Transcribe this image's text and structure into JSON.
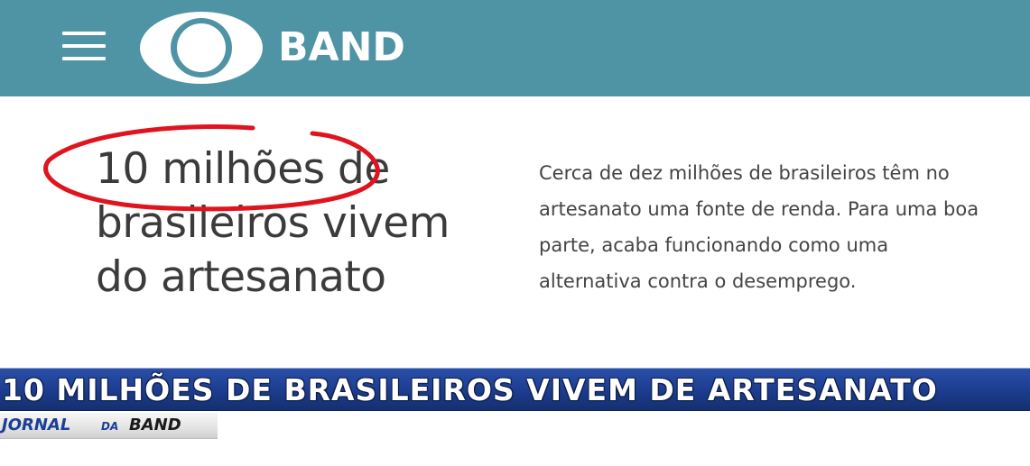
{
  "header": {
    "brand_name": "BAND",
    "menu_icon": "hamburger-menu-icon",
    "logo_icon": "band-eye-logo-icon",
    "background_color": "#4f94a4"
  },
  "article": {
    "headline": "10 milhões de brasileiros vivem do artesanato",
    "summary": "Cerca de dez milhões de brasileiros têm no artesanato uma fonte de renda. Para uma boa parte, acaba funcionando como uma alternativa contra o desemprego.",
    "highlight_color": "#e0141e"
  },
  "broadcast": {
    "chyron": "10 MILHÕES DE BRASILEIROS VIVEM DE ARTESANATO",
    "program_part1": "JORNAL",
    "program_part2": "DA",
    "program_part3": "BAND",
    "chyron_color": "#1c3c8e"
  }
}
